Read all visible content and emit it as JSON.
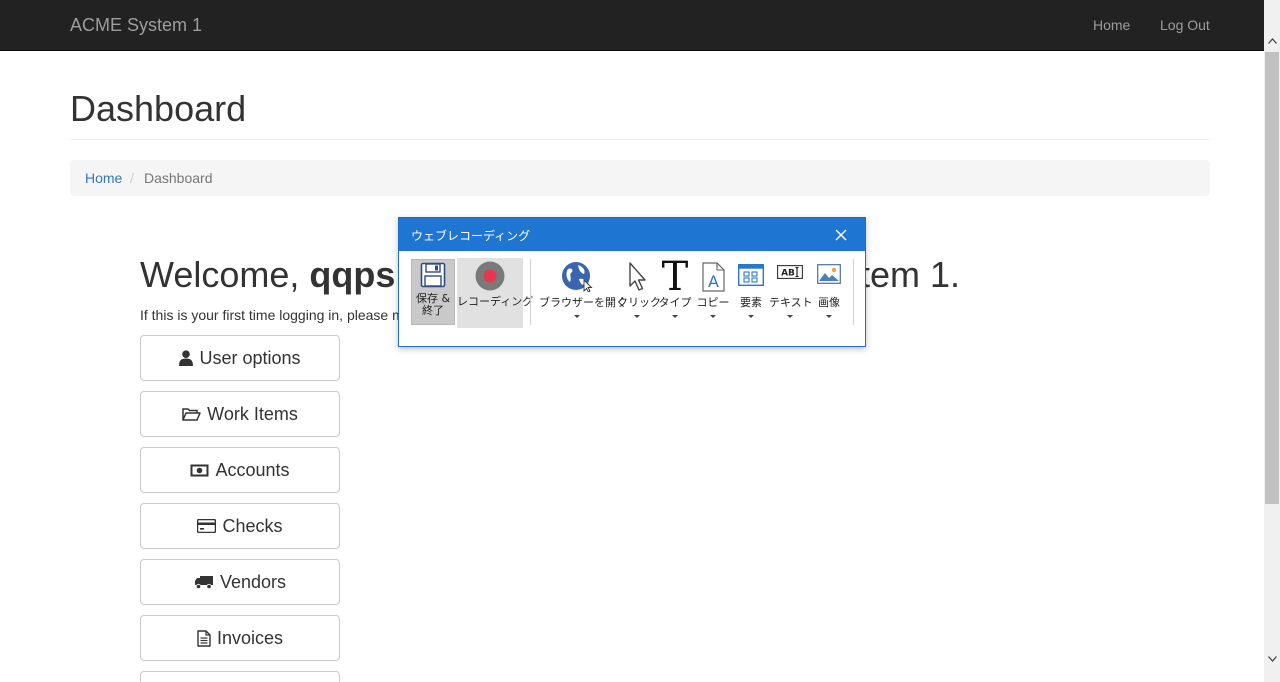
{
  "navbar": {
    "brand": "ACME System 1",
    "links": {
      "home": "Home",
      "logout": "Log Out"
    }
  },
  "page": {
    "title": "Dashboard",
    "breadcrumb": {
      "home": "Home",
      "separator": "/",
      "current": "Dashboard"
    }
  },
  "welcome": {
    "prefix": "Welcome, ",
    "username_visible": "qqps",
    "suffix_visible": "stem 1.",
    "intro_visible": "If this is your first time logging in, please m"
  },
  "menu": {
    "items": [
      {
        "label": "User options",
        "icon": "user-icon"
      },
      {
        "label": "Work Items",
        "icon": "folder-open-icon"
      },
      {
        "label": "Accounts",
        "icon": "money-icon"
      },
      {
        "label": "Checks",
        "icon": "credit-card-icon"
      },
      {
        "label": "Vendors",
        "icon": "truck-icon"
      },
      {
        "label": "Invoices",
        "icon": "file-text-icon"
      }
    ]
  },
  "recorder": {
    "title": "ウェブレコーディング",
    "tools": {
      "save": "保存 &\n終了",
      "record": "レコーディング",
      "open_browser": "ブラウザーを開く",
      "click": "クリック",
      "type": "タイプ",
      "copy": "コピー",
      "element": "要素",
      "text": "テキスト",
      "image": "画像"
    }
  },
  "colors": {
    "navbar_bg": "#222222",
    "link": "#337ab7",
    "dialog_title_bg": "#1e76d2",
    "record_red": "#e8364f"
  }
}
